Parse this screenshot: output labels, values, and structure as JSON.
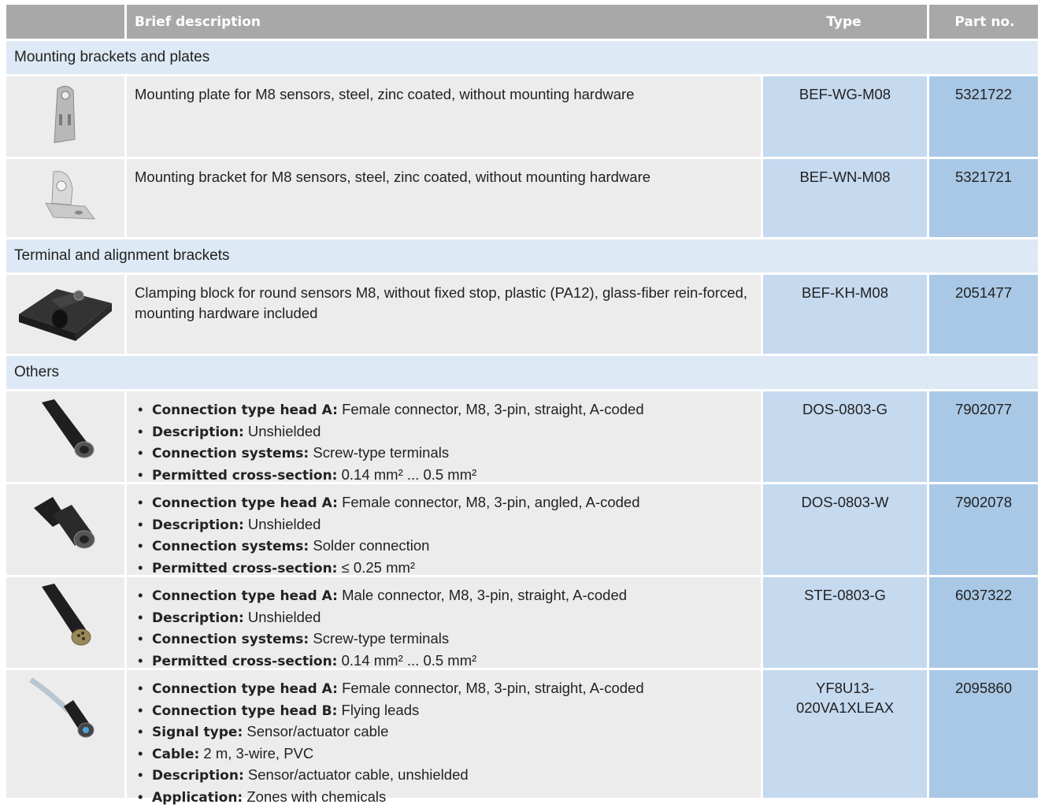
{
  "header": {
    "col_description": "Brief description",
    "col_type": "Type",
    "col_part": "Part no."
  },
  "groups": [
    {
      "title": "Mounting brackets and plates",
      "rows": [
        {
          "icon": "mounting-plate-icon",
          "description": "Mounting plate for M8 sensors, steel, zinc coated, without mounting hardware",
          "type": "BEF-WG-M08",
          "part": "5321722"
        },
        {
          "icon": "mounting-bracket-icon",
          "description": "Mounting bracket for M8 sensors, steel, zinc coated, without mounting hardware",
          "type": "BEF-WN-M08",
          "part": "5321721"
        }
      ]
    },
    {
      "title": "Terminal and alignment brackets",
      "rows": [
        {
          "icon": "clamping-block-icon",
          "description": "Clamping block for round sensors M8, without fixed stop, plastic (PA12), glass-fiber rein-forced, mounting hardware included",
          "type": "BEF-KH-M08",
          "part": "2051477"
        }
      ]
    },
    {
      "title": "Others",
      "rows": [
        {
          "icon": "female-connector-straight-icon",
          "specs": [
            {
              "label": "Connection type head A:",
              "value": "Female connector, M8, 3-pin, straight, A-coded"
            },
            {
              "label": "Description:",
              "value": "Unshielded"
            },
            {
              "label": "Connection systems:",
              "value": "Screw-type terminals"
            },
            {
              "label": "Permitted cross-section:",
              "value": "0.14 mm² ... 0.5 mm²"
            }
          ],
          "type": "DOS-0803-G",
          "part": "7902077"
        },
        {
          "icon": "female-connector-angled-icon",
          "specs": [
            {
              "label": "Connection type head A:",
              "value": "Female connector, M8, 3-pin, angled, A-coded"
            },
            {
              "label": "Description:",
              "value": "Unshielded"
            },
            {
              "label": "Connection systems:",
              "value": "Solder connection"
            },
            {
              "label": "Permitted cross-section:",
              "value": "≤ 0.25 mm²"
            }
          ],
          "type": "DOS-0803-W",
          "part": "7902078"
        },
        {
          "icon": "male-connector-straight-icon",
          "specs": [
            {
              "label": "Connection type head A:",
              "value": "Male connector, M8, 3-pin, straight, A-coded"
            },
            {
              "label": "Description:",
              "value": "Unshielded"
            },
            {
              "label": "Connection systems:",
              "value": "Screw-type terminals"
            },
            {
              "label": "Permitted cross-section:",
              "value": "0.14 mm² ... 0.5 mm²"
            }
          ],
          "type": "STE-0803-G",
          "part": "6037322"
        },
        {
          "icon": "sensor-cable-icon",
          "specs": [
            {
              "label": "Connection type head A:",
              "value": "Female connector, M8, 3-pin, straight, A-coded"
            },
            {
              "label": "Connection type head B:",
              "value": "Flying leads"
            },
            {
              "label": "Signal type:",
              "value": "Sensor/actuator cable"
            },
            {
              "label": "Cable:",
              "value": "2 m, 3-wire, PVC"
            },
            {
              "label": "Description:",
              "value": "Sensor/actuator cable, unshielded"
            },
            {
              "label": "Application:",
              "value": "Zones with chemicals"
            }
          ],
          "type": "YF8U13-020VA1XLEAX",
          "type_line1": "YF8U13-",
          "type_line2": "020VA1XLEAX",
          "part": "2095860"
        }
      ]
    }
  ]
}
